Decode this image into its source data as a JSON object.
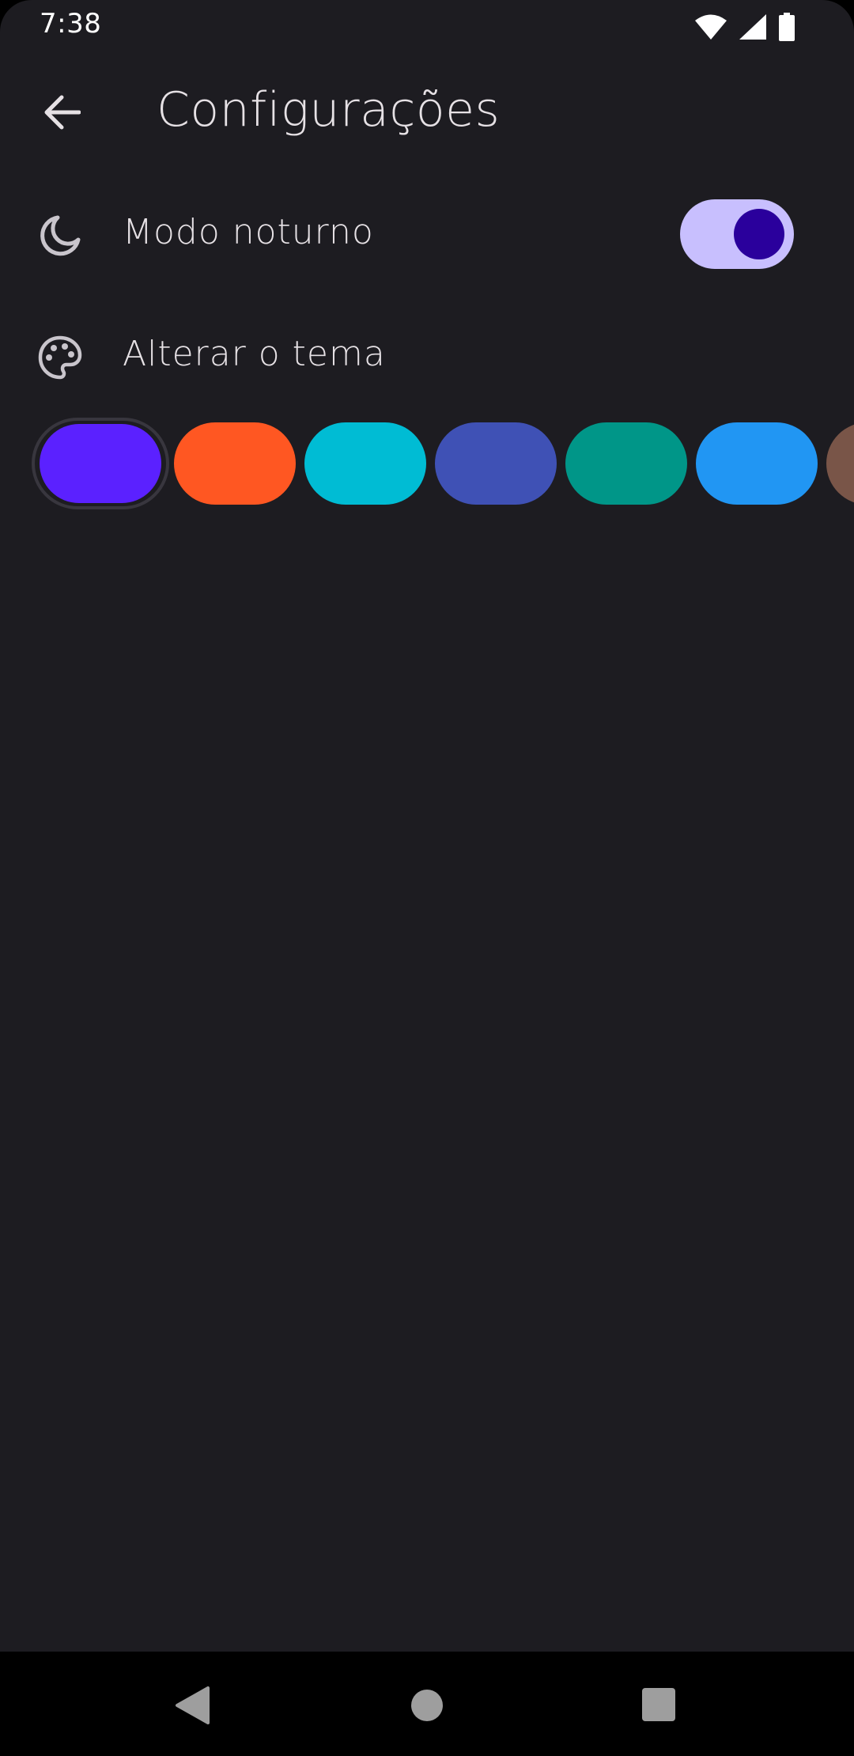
{
  "status_bar": {
    "time": "7:38",
    "icons": [
      "wifi-icon",
      "cell-signal-icon",
      "battery-icon"
    ]
  },
  "app_bar": {
    "back_icon": "arrow-back-icon",
    "title": "Configurações"
  },
  "settings": {
    "night_mode": {
      "icon": "moon-icon",
      "label": "Modo noturno",
      "enabled": true
    },
    "theme": {
      "icon": "palette-icon",
      "label": "Alterar o tema"
    }
  },
  "theme_swatches": {
    "selected_index": 0,
    "colors": [
      "#5b21ff",
      "#ff5722",
      "#00bcd4",
      "#3f51b5",
      "#009688",
      "#2196f3",
      "#795548"
    ]
  },
  "nav_bar": {
    "back": "nav-back-icon",
    "home": "nav-home-icon",
    "recents": "nav-recents-icon"
  },
  "colors": {
    "background": "#1d1c21",
    "text": "#e6e1e5",
    "switch_track": "#c8bffe",
    "switch_thumb": "#2a009c"
  }
}
